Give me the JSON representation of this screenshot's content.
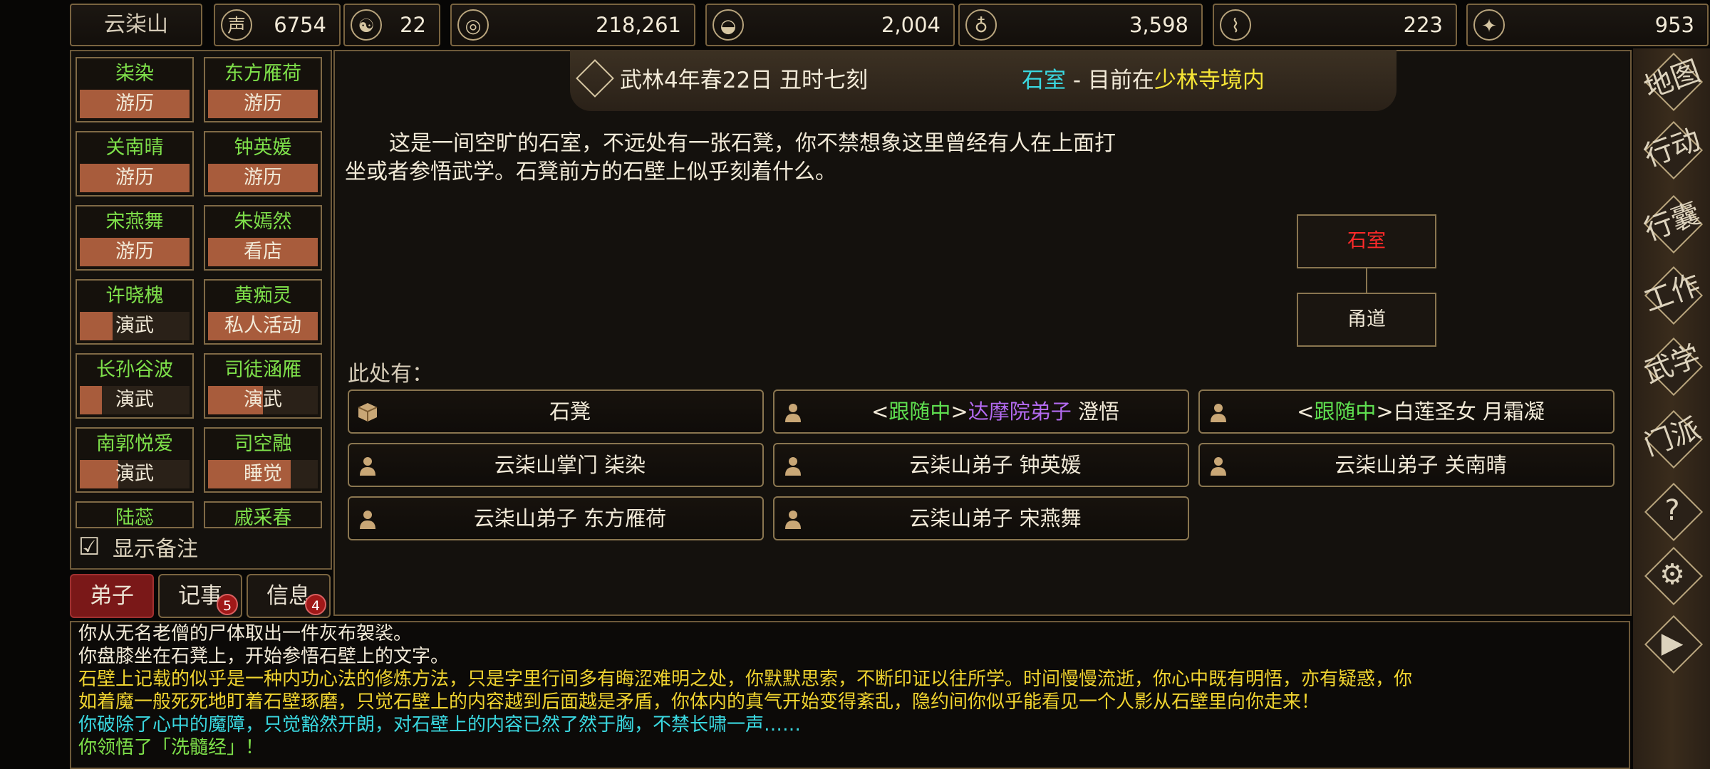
{
  "resources": {
    "sect_name": "云柒山",
    "items": [
      {
        "icon": "reputation-icon",
        "glyph": "声",
        "value": "6754"
      },
      {
        "icon": "yin-yang-icon",
        "glyph": "☯",
        "value": "22"
      },
      {
        "icon": "coin-icon",
        "glyph": "◎",
        "value": "218,261"
      },
      {
        "icon": "food-bowl-icon",
        "glyph": "◒",
        "value": "2,004"
      },
      {
        "icon": "gourd-icon",
        "glyph": "♁",
        "value": "3,598"
      },
      {
        "icon": "scroll-icon",
        "glyph": "⌇",
        "value": "223"
      },
      {
        "icon": "ore-icon",
        "glyph": "✦",
        "value": "953"
      }
    ]
  },
  "disciples": [
    {
      "name": "柒染",
      "status": "游历",
      "progress": 1.0
    },
    {
      "name": "东方雁荷",
      "status": "游历",
      "progress": 1.0
    },
    {
      "name": "关南晴",
      "status": "游历",
      "progress": 1.0
    },
    {
      "name": "钟英媛",
      "status": "游历",
      "progress": 1.0
    },
    {
      "name": "宋燕舞",
      "status": "游历",
      "progress": 1.0
    },
    {
      "name": "朱嫣然",
      "status": "看店",
      "progress": 1.0
    },
    {
      "name": "许晓槐",
      "status": "演武",
      "progress": 0.3
    },
    {
      "name": "黄痴灵",
      "status": "私人活动",
      "progress": 1.0
    },
    {
      "name": "长孙谷波",
      "status": "演武",
      "progress": 0.2
    },
    {
      "name": "司徒涵雁",
      "status": "演武",
      "progress": 0.5
    },
    {
      "name": "南郭悦爱",
      "status": "演武",
      "progress": 0.35
    },
    {
      "name": "司空融",
      "status": "睡觉",
      "progress": 0.75
    },
    {
      "name": "陆蕊",
      "status": "",
      "progress": 0
    },
    {
      "name": "戚采春",
      "status": "",
      "progress": 0
    }
  ],
  "show_notes_label": "显示备注",
  "tabs": [
    {
      "label": "弟子",
      "badge": ""
    },
    {
      "label": "记事",
      "badge": "5"
    },
    {
      "label": "信息",
      "badge": "4"
    }
  ],
  "header": {
    "date": "武林4年春22日 丑时七刻",
    "room": "石室",
    "sep": " - 目前在",
    "location": "少林寺境内"
  },
  "description": "这是一间空旷的石室，不远处有一张石凳，你不禁想象这里曾经有人在上面打坐或者参悟武学。石凳前方的石壁上似乎刻着什么。",
  "map": {
    "current": "石室",
    "connected": "甬道"
  },
  "here_label": "此处有：",
  "entities": [
    {
      "type": "object",
      "parts": [
        {
          "t": "石凳",
          "c": "#f2ead8"
        }
      ]
    },
    {
      "type": "person",
      "parts": [
        {
          "t": "<",
          "c": "#f2ead8"
        },
        {
          "t": "跟随中",
          "c": "#5fe050"
        },
        {
          "t": ">",
          "c": "#f2ead8"
        },
        {
          "t": "达摩院弟子",
          "c": "#b36af0"
        },
        {
          "t": " 澄悟",
          "c": "#f2ead8"
        }
      ]
    },
    {
      "type": "person",
      "parts": [
        {
          "t": "<",
          "c": "#f2ead8"
        },
        {
          "t": "跟随中",
          "c": "#5fe050"
        },
        {
          "t": ">白莲圣女 月霜凝",
          "c": "#f2ead8"
        }
      ]
    },
    {
      "type": "person",
      "parts": [
        {
          "t": "云柒山掌门 柒染",
          "c": "#f2ead8"
        }
      ]
    },
    {
      "type": "person",
      "parts": [
        {
          "t": "云柒山弟子 钟英媛",
          "c": "#f2ead8"
        }
      ]
    },
    {
      "type": "person",
      "parts": [
        {
          "t": "云柒山弟子 关南晴",
          "c": "#f2ead8"
        }
      ]
    },
    {
      "type": "person",
      "parts": [
        {
          "t": "云柒山弟子 东方雁荷",
          "c": "#f2ead8"
        }
      ]
    },
    {
      "type": "person",
      "parts": [
        {
          "t": "云柒山弟子 宋燕舞",
          "c": "#f2ead8"
        }
      ]
    }
  ],
  "menu": [
    {
      "label": "地图",
      "icon": "map-icon"
    },
    {
      "label": "行动",
      "icon": "action-icon"
    },
    {
      "label": "行囊",
      "icon": "bag-icon"
    },
    {
      "label": "工作",
      "icon": "work-icon"
    },
    {
      "label": "武学",
      "icon": "martial-icon"
    },
    {
      "label": "门派",
      "icon": "sect-icon"
    },
    {
      "label": "?",
      "icon": "help-icon"
    },
    {
      "label": "⚙",
      "icon": "gear-icon"
    },
    {
      "label": "▶",
      "icon": "play-icon"
    }
  ],
  "log": [
    {
      "text": "你从无名老僧的尸体取出一件灰布袈裟。",
      "color": "#f2ead8"
    },
    {
      "text": "你盘膝坐在石凳上，开始参悟石壁上的文字。",
      "color": "#f2ead8"
    },
    {
      "text": "石壁上记载的似乎是一种内功心法的修炼方法，只是字里行间多有晦涩难明之处，你默默思索，不断印证以往所学。时间慢慢流逝，你心中既有明悟，亦有疑惑，你",
      "color": "#f0d430"
    },
    {
      "text": "如着魔一般死死地盯着石壁琢磨，只觉石壁上的内容越到后面越是矛盾，你体内的真气开始变得紊乱，隐约间你似乎能看见一个人影从石壁里向你走来！",
      "color": "#f0d430"
    },
    {
      "text": "你破除了心中的魔障，只觉豁然开朗，对石壁上的内容已然了然于胸，不禁长啸一声……",
      "color": "#3ad8e0"
    },
    {
      "text": "你领悟了「洗髓经」！",
      "color": "#7ee04a"
    }
  ],
  "colors": {
    "room_highlight": "#ff2a2a",
    "location": "#f5e436",
    "room_header": "#3ad8e0"
  }
}
